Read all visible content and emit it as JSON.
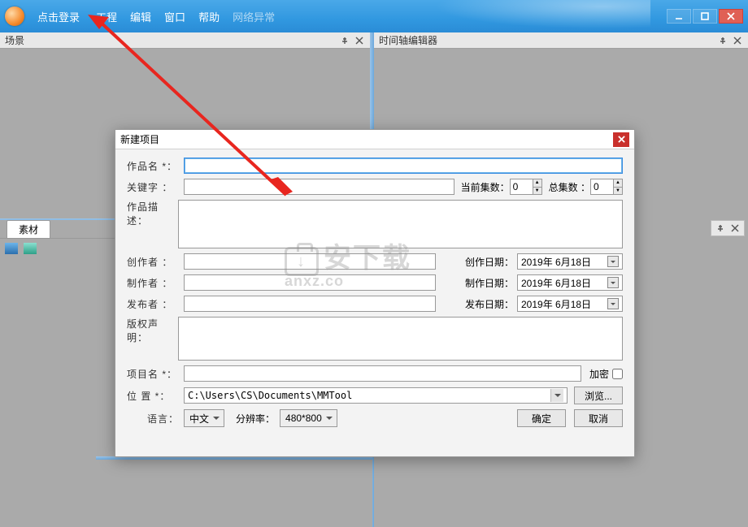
{
  "titlebar": {
    "login": "点击登录",
    "menu": [
      "工程",
      "编辑",
      "窗口",
      "帮助"
    ],
    "net_status": "网络异常"
  },
  "panels": {
    "scene": "场景",
    "timeline": "时间轴编辑器",
    "material_tab": "素材"
  },
  "dialog": {
    "title": "新建项目",
    "labels": {
      "work_name": "作品名 *：",
      "keywords": "关键字 ：",
      "cur_ep": "当前集数：",
      "total_ep": "总集数 ：",
      "desc": "作品描述：",
      "creator": "创作者 ：",
      "producer": "制作者 ：",
      "publisher": "发布者 ：",
      "copyright": "版权声明：",
      "project_name": "项目名 *：",
      "encrypt": "加密",
      "location": "位 置 *：",
      "browse": "浏览...",
      "language": "语言：",
      "resolution": "分辨率：",
      "create_date": "创作日期：",
      "produce_date": "制作日期：",
      "publish_date": "发布日期："
    },
    "values": {
      "cur_ep": "0",
      "total_ep": "0",
      "date": "2019年 6月18日",
      "location": "C:\\Users\\CS\\Documents\\MMTool",
      "language": "中文",
      "resolution": "480*800"
    },
    "buttons": {
      "ok": "确定",
      "cancel": "取消"
    }
  },
  "watermark": {
    "cn": "安下载",
    "en": "anxz.co"
  }
}
